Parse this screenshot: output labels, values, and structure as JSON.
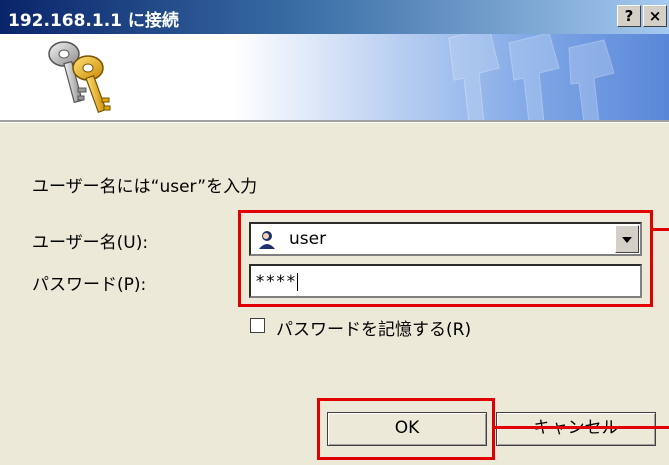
{
  "titlebar": {
    "title": "192.168.1.1 に接続",
    "help_label": "?",
    "close_label": "×"
  },
  "instruction": "ユーザー名には“user”を入力",
  "form": {
    "username_label": "ユーザー名(U):",
    "username_value": "user",
    "password_label": "パスワード(P):",
    "password_value": "****",
    "remember_label": "パスワードを記憶する(R)",
    "remember_checked": false
  },
  "buttons": {
    "ok_label": "OK",
    "cancel_label": "キャンセル"
  },
  "colors": {
    "highlight": "#e00000",
    "titlebar": "#0a246a",
    "dialog_bg": "#ece9d8"
  },
  "icons": [
    "key-icon",
    "user-icon",
    "dropdown-arrow-icon"
  ]
}
